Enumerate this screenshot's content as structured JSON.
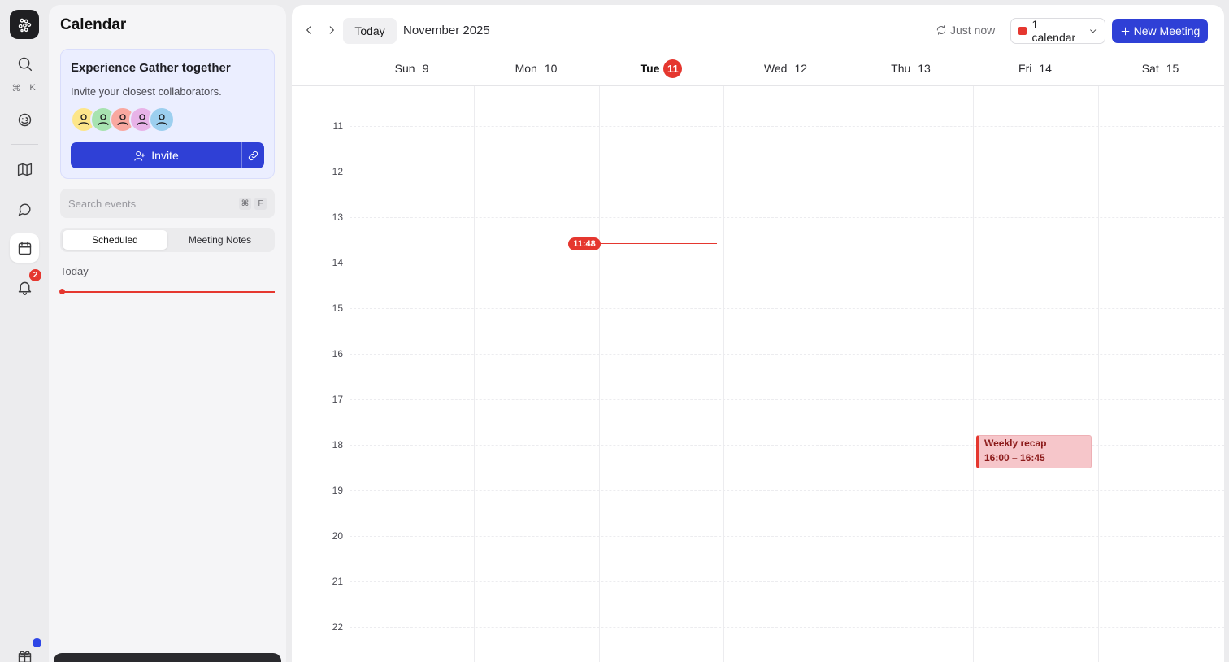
{
  "rail": {
    "shortcut_keys": [
      "⌘",
      "K"
    ],
    "notifications_count": "2"
  },
  "panel": {
    "title": "Calendar",
    "promo": {
      "title": "Experience Gather together",
      "subtitle": "Invite your closest collaborators.",
      "avatar_colors": [
        "#fde68a",
        "#a7e3b0",
        "#f9a8a0",
        "#e8b3e8",
        "#9ccfef"
      ],
      "invite_label": "Invite"
    },
    "search": {
      "placeholder": "Search events",
      "shortcut_keys": [
        "⌘",
        "F"
      ]
    },
    "tabs": [
      {
        "label": "Scheduled",
        "active": true
      },
      {
        "label": "Meeting Notes",
        "active": false
      }
    ],
    "today_label": "Today"
  },
  "calendar": {
    "today_button": "Today",
    "month": "November 2025",
    "sync_status": "Just now",
    "calendar_select": "1 calendar",
    "new_meeting": "New Meeting",
    "days": [
      {
        "name": "Sun",
        "num": "9",
        "today": false
      },
      {
        "name": "Mon",
        "num": "10",
        "today": false
      },
      {
        "name": "Tue",
        "num": "11",
        "today": true
      },
      {
        "name": "Wed",
        "num": "12",
        "today": false
      },
      {
        "name": "Thu",
        "num": "13",
        "today": false
      },
      {
        "name": "Fri",
        "num": "14",
        "today": false
      },
      {
        "name": "Sat",
        "num": "15",
        "today": false
      }
    ],
    "hours": [
      "11",
      "12",
      "13",
      "14",
      "15",
      "16",
      "17",
      "18",
      "19",
      "20",
      "21",
      "22"
    ],
    "current_time": "11:48",
    "events": [
      {
        "title": "Weekly recap",
        "time": "16:00 – 16:45",
        "day": "Fri"
      }
    ],
    "colors": {
      "accent": "#2f40d6",
      "now": "#e5372f",
      "event_bg": "#f6c6ca"
    }
  }
}
